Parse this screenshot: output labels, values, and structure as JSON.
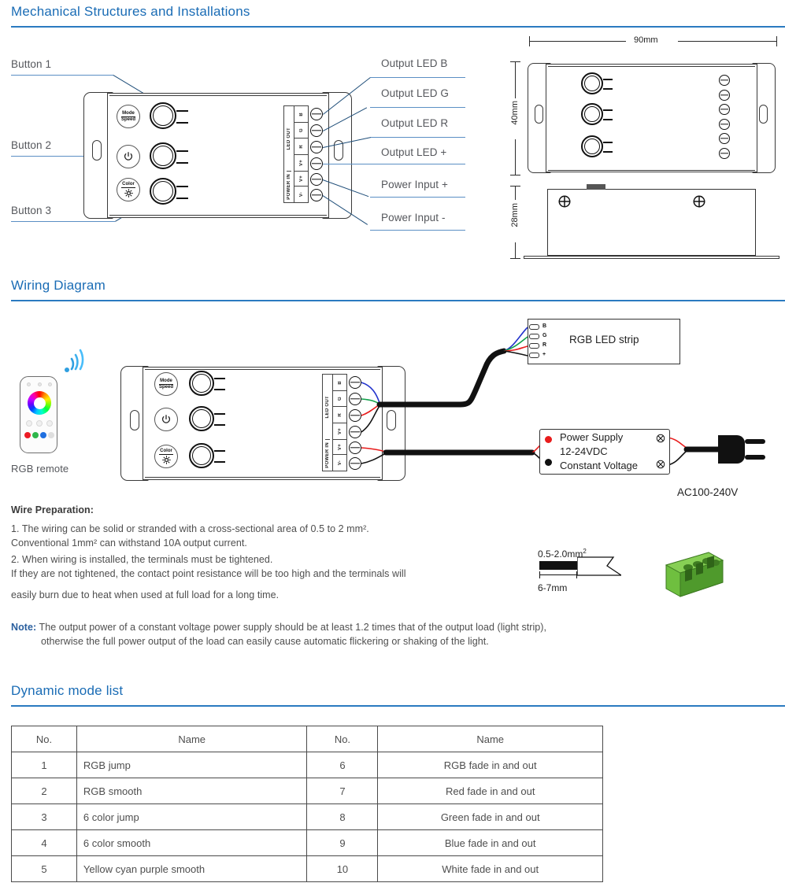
{
  "sections": {
    "mechanical": "Mechanical Structures and Installations",
    "wiring": "Wiring Diagram",
    "dynamic": "Dynamic mode list"
  },
  "mechanical": {
    "left_labels": [
      "Button 1",
      "Button 2",
      "Button 3"
    ],
    "right_labels": [
      "Output LED B",
      "Output LED G",
      "Output LED R",
      "Output LED +",
      "Power Input +",
      "Power Input -"
    ],
    "button_faces": [
      {
        "top": "Mode",
        "bottom": "Speed"
      },
      {
        "top": "",
        "bottom": "power-icon"
      },
      {
        "top": "Color",
        "bottom": "brightness-icon"
      }
    ],
    "terminal_groups": [
      {
        "name": "LED OUT",
        "pins": [
          "B",
          "G",
          "R",
          "V+"
        ]
      },
      {
        "name": "POWER IN",
        "pins": [
          "V+",
          "V-"
        ]
      }
    ],
    "dimensions": {
      "width": "90mm",
      "height": "40mm",
      "depth": "28mm"
    }
  },
  "wiring": {
    "remote_caption": "RGB remote",
    "strip_label": "RGB LED strip",
    "strip_pins": [
      "B",
      "G",
      "R",
      "+"
    ],
    "power_supply_lines": [
      "Power Supply",
      "12-24VDC",
      "Constant Voltage"
    ],
    "ac_label": "AC100-240V",
    "terminal_groups": [
      {
        "name": "LED OUT",
        "pins": [
          "B",
          "G",
          "R",
          "V+"
        ]
      },
      {
        "name": "POWER IN",
        "pins": [
          "V+",
          "V-"
        ]
      }
    ]
  },
  "wire_prep": {
    "title": "Wire Preparation:",
    "items": [
      "1. The wiring can be solid or stranded with a cross-sectional area of 0.5 to 2 mm².",
      "    Conventional 1mm² can withstand 10A output current.",
      "2. When wiring is installed, the terminals must be tightened.",
      "    If they are not tightened, the contact point resistance will be too high and the terminals will",
      "    easily burn due to heat when used at full load for a long time."
    ],
    "note_label": "Note:",
    "note_lines": [
      "The output power of a constant voltage power supply should be at least 1.2 times that of the output load (light strip),",
      "otherwise the full power output of the load can easily cause automatic flickering or shaking of the light."
    ],
    "figure": {
      "area_label": "0.5-2.0mm",
      "area_sup": "2",
      "strip_label": "6-7mm"
    }
  },
  "modes_table": {
    "headers": [
      "No.",
      "Name",
      "No.",
      "Name"
    ],
    "rows": [
      [
        "1",
        "RGB jump",
        "6",
        "RGB fade in and out"
      ],
      [
        "2",
        "RGB smooth",
        "7",
        "Red fade in and out"
      ],
      [
        "3",
        "6 color jump",
        "8",
        "Green fade in and out"
      ],
      [
        "4",
        "6 color smooth",
        "9",
        "Blue fade in and out"
      ],
      [
        "5",
        "Yellow cyan purple smooth",
        "10",
        "White fade in and out"
      ]
    ]
  },
  "colors": {
    "heading": "#1a6cb5",
    "rule": "#2a7ac0",
    "leader": "#1f4e79",
    "label_underline": "#5b8fc4",
    "wire_red": "#e81c1c",
    "wire_green": "#11a04a",
    "wire_blue": "#2233cc",
    "wire_black": "#111111",
    "terminal_green": "#5aa832"
  }
}
